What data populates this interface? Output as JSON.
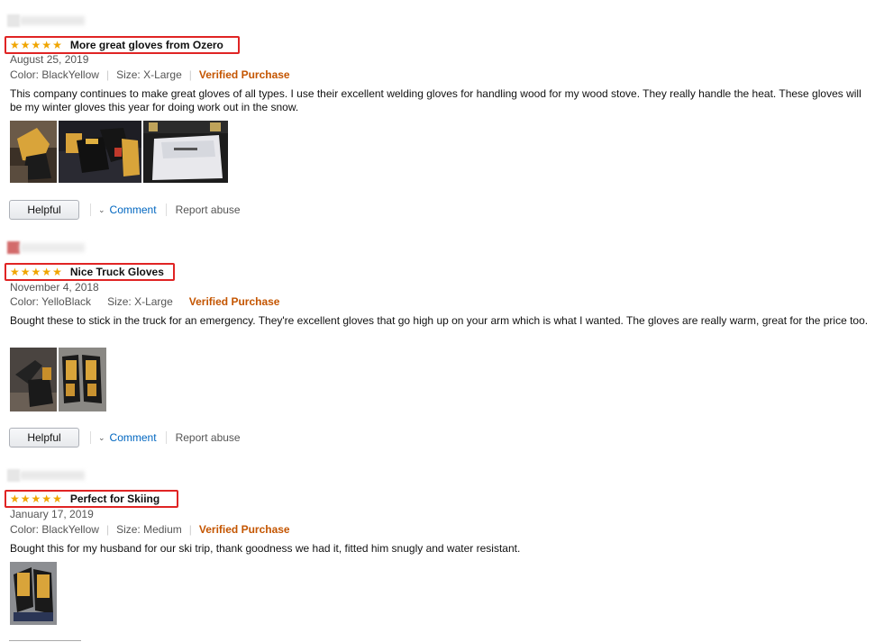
{
  "reviews": [
    {
      "title": "More great gloves from Ozero",
      "rating": 5,
      "date": "August 25, 2019",
      "color": "Color: BlackYellow",
      "size": "Size: X-Large",
      "verified": "Verified Purchase",
      "body": "This company continues to make great gloves of all types. I use their excellent welding gloves for handling wood for my wood stove. They really handle the heat. These gloves will be my winter gloves this year for doing work out in the snow.",
      "photo_count": 3
    },
    {
      "title": "Nice Truck Gloves",
      "rating": 5,
      "date": "November 4, 2018",
      "color": "Color: YelloBlack",
      "size": "Size: X-Large",
      "verified": "Verified Purchase",
      "body": "Bought these to stick in the truck for an emergency. They're excellent gloves that go high up on your arm which is what I wanted. The gloves are really warm, great for the price too.",
      "photo_count": 2
    },
    {
      "title": "Perfect for Skiing",
      "rating": 5,
      "date": "January 17, 2019",
      "color": "Color: BlackYellow",
      "size": "Size: Medium",
      "verified": "Verified Purchase",
      "body": "Bought this for my husband for our ski trip, thank goodness we had it, fitted him snugly and water resistant.",
      "photo_count": 1
    }
  ],
  "actions": {
    "helpful_label": "Helpful",
    "comment_label": "Comment",
    "report_label": "Report abuse"
  },
  "colors": {
    "star": "#f0a500",
    "highlight_border": "#e02424",
    "verified": "#c45500",
    "link": "#0066c0"
  }
}
